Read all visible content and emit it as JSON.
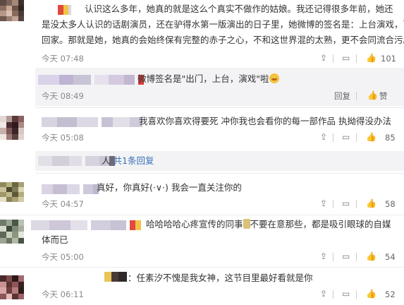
{
  "comments": [
    {
      "text_lines": [
        "认识这么多年，她真的就是这么个真实不做作的姑娘。我还记得很多年前，她还",
        "是没太多人认识的话剧演员，还在驴得水第一版演出的日子里，她微博的签名是：上台演戏，下台",
        "回家。那就是她，她真的会始终保有完整的赤子之心，不和这世界混的太熟，更不会同流合污。"
      ],
      "time": "今天 07:48",
      "like_count": "101"
    },
    {
      "text": "我喜欢你喜欢得要死 冲你我也会看你的每一部作品 执拗得没办法",
      "time": "今天 05:08",
      "like_count": "85"
    },
    {
      "text": "真好，你真好(·∨·)       我会一直关注你的",
      "time": "今天 04:57",
      "like_count": "58"
    },
    {
      "text_line1_a": "哈哈哈哈心疼宣传的同事",
      "text_line1_b": "不要在意那些，都是吸引眼球的自媒",
      "text_line2": "体而已",
      "time": "今天 05:00",
      "like_count": "54"
    },
    {
      "text": "：任素汐不愧是我女神，这节目里最好看就是你",
      "time": "今天 06:11",
      "like_count": "52"
    }
  ],
  "reply1": {
    "text": "微博签名是\"出门，上台，演戏\"啦",
    "time": "今天 08:49",
    "reply_label": "回复",
    "like_label": "赞"
  },
  "reply_summary": {
    "suffix": "人",
    "count_link": "共1条回复"
  },
  "labels": {
    "reply": "回复"
  }
}
